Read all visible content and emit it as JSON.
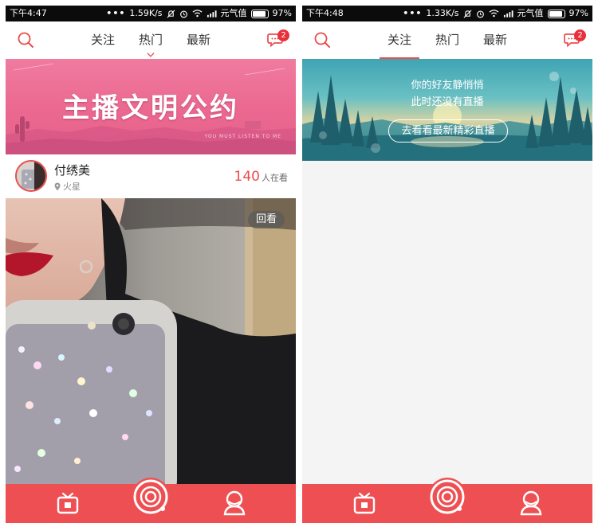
{
  "left_screen": {
    "status": {
      "time": "下午4:47",
      "speed": "1.59K/s",
      "carrier": "元气值",
      "battery": "97%"
    },
    "nav": {
      "tabs": [
        "关注",
        "热门",
        "最新"
      ],
      "active": "热门",
      "badge_count": "2"
    },
    "banner": {
      "title": "主播文明公约",
      "subtitle": "YOU MUST LISTEN TO ME"
    },
    "user": {
      "name": "付绣美",
      "location": "火星",
      "viewer_count": "140",
      "viewer_suffix": "人在看"
    },
    "video": {
      "replay_label": "回看"
    }
  },
  "right_screen": {
    "status": {
      "time": "下午4:48",
      "speed": "1.33K/s",
      "carrier": "元气值",
      "battery": "97%"
    },
    "nav": {
      "tabs": [
        "关注",
        "热门",
        "最新"
      ],
      "active": "关注",
      "badge_count": "2"
    },
    "empty_state": {
      "line1": "你的好友静悄悄",
      "line2": "此时还没有直播",
      "button": "去看看最新精彩直播"
    }
  },
  "colors": {
    "accent": "#e94d4d",
    "bottom_bar": "#ee4f52",
    "banner_pink": "#ec6b92"
  }
}
